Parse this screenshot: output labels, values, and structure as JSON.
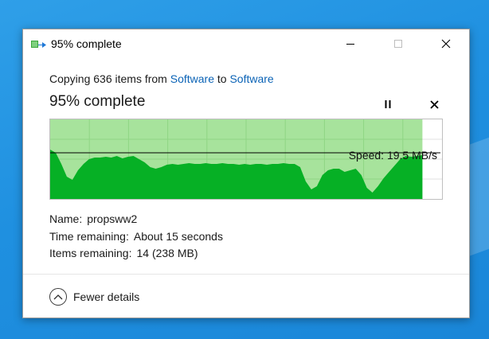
{
  "window": {
    "title": "95% complete",
    "controls": {
      "minimize": "minimize",
      "maximize": "maximize",
      "close": "close"
    }
  },
  "copy": {
    "prefix": "Copying 636 items from ",
    "source": "Software",
    "middle": " to ",
    "destination": "Software"
  },
  "progress": {
    "heading": "95% complete",
    "percent": 95,
    "speed_label": "Speed: 19.5 MB/s",
    "speed_level_fraction": 0.58,
    "throughput_profile": [
      0.62,
      0.58,
      0.44,
      0.28,
      0.24,
      0.36,
      0.44,
      0.5,
      0.52,
      0.52,
      0.53,
      0.52,
      0.54,
      0.51,
      0.53,
      0.54,
      0.5,
      0.46,
      0.4,
      0.38,
      0.4,
      0.43,
      0.44,
      0.43,
      0.44,
      0.45,
      0.44,
      0.44,
      0.45,
      0.44,
      0.44,
      0.45,
      0.44,
      0.44,
      0.43,
      0.44,
      0.43,
      0.44,
      0.44,
      0.43,
      0.44,
      0.44,
      0.45,
      0.44,
      0.44,
      0.4,
      0.22,
      0.12,
      0.16,
      0.3,
      0.36,
      0.38,
      0.38,
      0.34,
      0.36,
      0.38,
      0.3,
      0.14,
      0.08,
      0.16,
      0.26,
      0.34,
      0.42,
      0.5,
      0.54,
      0.53,
      0.54,
      0.55
    ],
    "colors": {
      "filled": "#06b025",
      "track": "#a7e39c",
      "grid": "#8fd584",
      "line": "#000000"
    }
  },
  "details": {
    "name_label": "Name:",
    "name_value": "propsww2",
    "time_label": "Time remaining:",
    "time_value": "About 15 seconds",
    "items_label": "Items remaining:",
    "items_value": "14 (238 MB)"
  },
  "footer": {
    "toggle_label": "Fewer details"
  },
  "icons": {
    "app": "file-copy-icon",
    "pause": "pause-icon",
    "stop": "close-icon",
    "toggle": "chevron-up-icon"
  }
}
